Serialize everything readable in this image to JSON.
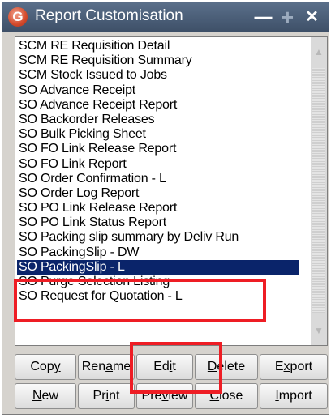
{
  "window": {
    "title": "Report Customisation",
    "logo_letter": "G"
  },
  "title_buttons": {
    "minimize": "—",
    "maximize": "+",
    "close": "✕"
  },
  "list": {
    "items": [
      "SCM RE Requisition Detail",
      "SCM RE Requisition Summary",
      "SCM Stock Issued to Jobs",
      "SO Advance Receipt",
      "SO Advance Receipt Report",
      "SO Backorder Releases",
      "SO Bulk Picking Sheet",
      "SO FO Link Release Report",
      "SO FO Link Report",
      "SO Order Confirmation - L",
      "SO Order Log Report",
      "SO PO Link Release Report",
      "SO PO Link Status Report",
      "SO Packing slip summary by Deliv Run",
      "SO PackingSlip - DW",
      "SO PackingSlip - L",
      "SO Purge Selection Listing",
      "SO Request for Quotation - L"
    ],
    "selected_index": 15
  },
  "buttons": {
    "row1": [
      {
        "pre": "Cop",
        "u": "y",
        "post": ""
      },
      {
        "pre": "Ren",
        "u": "a",
        "post": "me"
      },
      {
        "pre": "Ed",
        "u": "i",
        "post": "t"
      },
      {
        "pre": "",
        "u": "D",
        "post": "elete"
      },
      {
        "pre": "E",
        "u": "x",
        "post": "port"
      }
    ],
    "row2": [
      {
        "pre": "",
        "u": "N",
        "post": "ew"
      },
      {
        "pre": "Pr",
        "u": "i",
        "post": "nt"
      },
      {
        "pre": "Pre",
        "u": "v",
        "post": "iew"
      },
      {
        "pre": "",
        "u": "C",
        "post": "lose"
      },
      {
        "pre": "",
        "u": "I",
        "post": "mport"
      }
    ]
  },
  "colors": {
    "highlight": "#ee1d24",
    "selection": "#0a246a",
    "titlebar": "#4a5d78"
  }
}
